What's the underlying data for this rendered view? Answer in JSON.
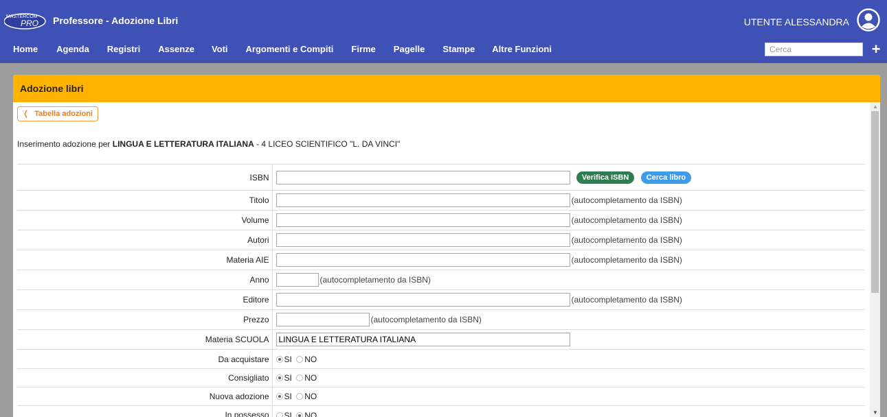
{
  "header": {
    "logo_text_top": "MASTERCOM",
    "logo_text_bottom": "PRO",
    "title": "Professore - Adozione Libri",
    "user": "UTENTE ALESSANDRA"
  },
  "nav": [
    "Home",
    "Agenda",
    "Registri",
    "Assenze",
    "Voti",
    "Argomenti e Compiti",
    "Firme",
    "Pagelle",
    "Stampe",
    "Altre Funzioni"
  ],
  "search": {
    "placeholder": "Cerca"
  },
  "panel": {
    "title": "Adozione libri",
    "back_label": "Tabella adozioni",
    "intro_prefix": "Inserimento adozione per ",
    "intro_subject": "LINGUA E LETTERATURA ITALIANA",
    "intro_suffix": " - 4 LICEO SCIENTIFICO \"L. DA VINCI\""
  },
  "form": {
    "isbn_label": "ISBN",
    "verifica_label": "Verifica ISBN",
    "cerca_label": "Cerca libro",
    "titolo_label": "Titolo",
    "volume_label": "Volume",
    "autori_label": "Autori",
    "materia_aie_label": "Materia AIE",
    "anno_label": "Anno",
    "editore_label": "Editore",
    "prezzo_label": "Prezzo",
    "materia_scuola_label": "Materia SCUOLA",
    "materia_scuola_value": "LINGUA E LETTERATURA ITALIANA",
    "hint": "(autocompletamento da ISBN)",
    "da_acquistare_label": "Da acquistare",
    "consigliato_label": "Consigliato",
    "nuova_adozione_label": "Nuova adozione",
    "in_possesso_label": "In possesso",
    "si": "SI",
    "no": "NO"
  }
}
